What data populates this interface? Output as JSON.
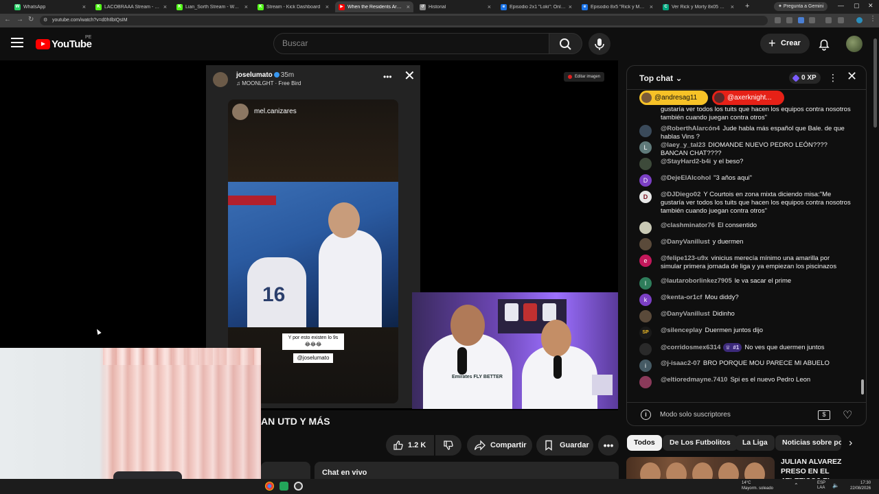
{
  "browser": {
    "tabs": [
      {
        "title": "WhatsApp",
        "color": "#25d366",
        "glyph": "W"
      },
      {
        "title": "LACOBRAAA Stream - Watch Li",
        "color": "#53fc18",
        "glyph": "K"
      },
      {
        "title": "Lian_Sorth Stream - Watch Liv",
        "color": "#53fc18",
        "glyph": "K"
      },
      {
        "title": "Stream - Kick Dashboard",
        "color": "#53fc18",
        "glyph": "K"
      },
      {
        "title": "When the Residents Aren't",
        "color": "#ff0000",
        "glyph": "▶"
      },
      {
        "title": "Historial",
        "color": "#8a8a8a",
        "glyph": "↺"
      },
      {
        "title": "Episodio 2x1 \"Loki\": Online HD",
        "color": "#1a73e8",
        "glyph": "e"
      },
      {
        "title": "Episodio 8x5 \"Rick y Morty\": O",
        "color": "#1a73e8",
        "glyph": "e"
      },
      {
        "title": "Ver Rick y Morty 8x05 Online",
        "color": "#00a67e",
        "glyph": "C"
      }
    ],
    "gemini_label": "Pregunta a Gemini",
    "url": "youtube.com/watch?v=d0hIlbIQsIM"
  },
  "youtube": {
    "logo_text": "YouTube",
    "region": "PE",
    "search_placeholder": "Buscar",
    "create_label": "Crear"
  },
  "video": {
    "story_user": "joselumato",
    "story_time": "35m",
    "story_music": "MOONLGHT · Free Bird",
    "inner_user": "mel.canizares",
    "caption_1": "Y por esto existen lo 9s 😂😂😂",
    "caption_2": "@joselumato",
    "edit_image_label": "Editar imagen",
    "jersey_number": "16",
    "kit_sponsor": "Emirates FLY BETTER",
    "title_visible": "AN UTD Y MÁS",
    "like_count": "1.2 K",
    "share_label": "Compartir",
    "save_label": "Guardar",
    "live_chat_label": "Chat en vivo"
  },
  "chat": {
    "header": "Top chat",
    "xp": "0 XP",
    "pinned": [
      "@andresag11",
      "@axerknight..."
    ],
    "messages": [
      {
        "author": "",
        "text": "gustaría ver todos los tuits que hacen los equipos contra nosotros también cuando juegan contra otros\"",
        "avatar_color": "#555",
        "initial": ""
      },
      {
        "author": "@RoberthAlarcón4",
        "text": "Jude habla más español que Bale. de que hablas Vins ?",
        "avatar_color": "#3a4a5a",
        "initial": ""
      },
      {
        "author": "@laey_y_tal23",
        "text": "DIOMANDE NUEVO PEDRO LEÓN???? BANCAN CHAT????",
        "avatar_color": "#5f7a7a",
        "initial": "L"
      },
      {
        "author": "@StayHard2-b4i",
        "text": "y el beso?",
        "avatar_color": "#3d4a3a",
        "initial": ""
      },
      {
        "author": "@DejeElAlcohol",
        "text": "\"3 años aqui\"",
        "avatar_color": "#7b3fc4",
        "initial": "D"
      },
      {
        "author": "@DJDiego02",
        "text": "Y Courtois en zona mixta diciendo misa:\"Me gustaría ver todos los tuits que hacen los equipos contra nosotros también cuando juegan contra otros\"",
        "avatar_color": "#e8e8e8",
        "initial": "D"
      },
      {
        "author": "@clashminator76",
        "text": "El consentido",
        "avatar_color": "#c9c9b5",
        "initial": ""
      },
      {
        "author": "@DanyVanillust",
        "text": "y duermen",
        "avatar_color": "#5a4a3a",
        "initial": ""
      },
      {
        "author": "@felipe123-u9x",
        "text": "vinicius merecía mínimo una amarilla por simular primera jornada de liga y ya empiezan los piscinazos",
        "avatar_color": "#c2185b",
        "initial": "e"
      },
      {
        "author": "@lautaroborlinkez7905",
        "text": "le va sacar el prime",
        "avatar_color": "#2e7d5b",
        "initial": "l"
      },
      {
        "author": "@kenta-or1cf",
        "text": "Mou diddy?",
        "avatar_color": "#7b3fc4",
        "initial": "k"
      },
      {
        "author": "@DanyVanillust",
        "text": "Didinho",
        "avatar_color": "#5a4a3a",
        "initial": ""
      },
      {
        "author": "@silenceplay",
        "text": "Duermen juntos dijo",
        "avatar_color": "#1a1a1a",
        "initial": "SP"
      },
      {
        "author": "@corridosmex6314",
        "badge": "#1",
        "text": "No ves que duermen juntos",
        "avatar_color": "#2a2a2a",
        "initial": ""
      },
      {
        "author": "@j-isaac2-07",
        "text": "BRO PORQUE MOU PARECE MI ABUELO",
        "avatar_color": "#455a64",
        "initial": "i"
      },
      {
        "author": "@eltioredmayne.7410",
        "text": "Spi es el nuevo Pedro Leon",
        "avatar_color": "#8a3a5a",
        "initial": ""
      }
    ],
    "footer_mode": "Modo solo suscriptores"
  },
  "chips": [
    "Todos",
    "De Los Futbolitos",
    "La Liga",
    "Noticias sobre po"
  ],
  "recommended": {
    "title": "JULIAN ALVAREZ PRESO EN EL ATLETICO? EL"
  },
  "taskbar": {
    "weather_temp": "14°C",
    "weather_desc": "Mayorm. soleado",
    "lang_1": "ESP",
    "lang_2": "LAA",
    "time": "17:30",
    "date": "22/08/2026"
  }
}
